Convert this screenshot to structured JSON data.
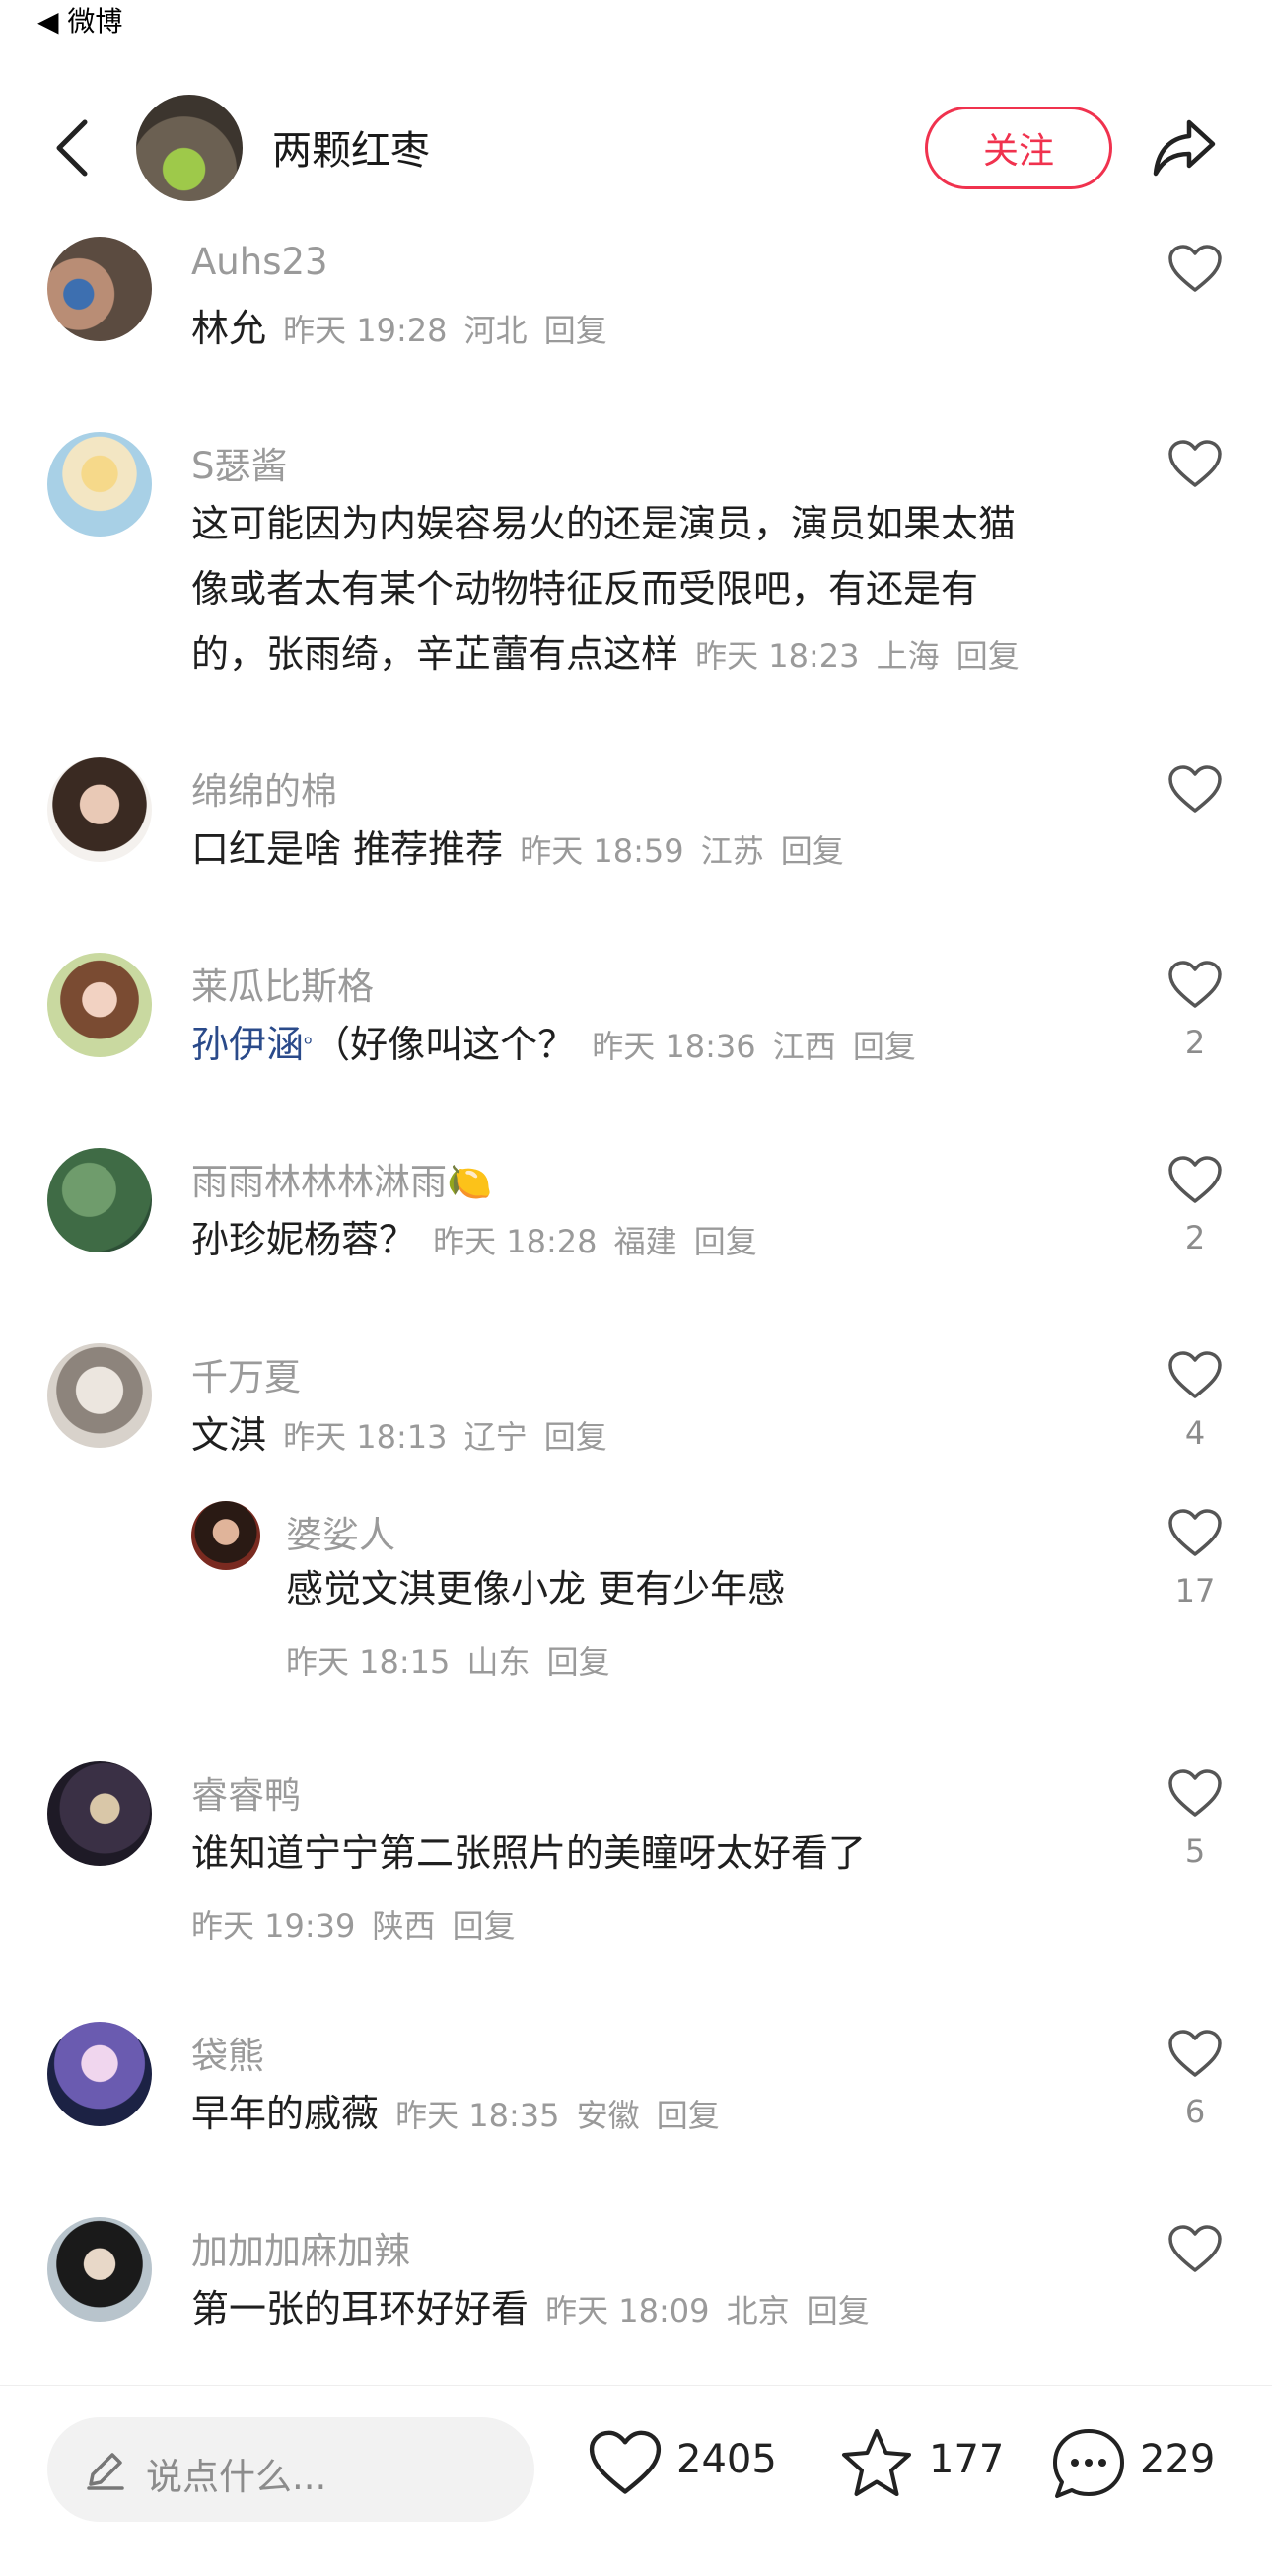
{
  "status_bar": {
    "back_app": "◀ 微博"
  },
  "header": {
    "user_name": "两颗红枣",
    "follow_label": "关注"
  },
  "comments": [
    {
      "name": "Auhs23",
      "text": "林允",
      "time": "昨天 19:28",
      "location": "河北",
      "reply": "回复",
      "likes": ""
    },
    {
      "name": "S瑟酱",
      "line1": "这可能因为内娱容易火的还是演员，演员如果太猫",
      "line2": "像或者太有某个动物特征反而受限吧，有还是有",
      "line3": "的，张雨绮，辛芷蕾有点这样",
      "time": "昨天 18:23",
      "location": "上海",
      "reply": "回复",
      "likes": ""
    },
    {
      "name": "绵绵的棉",
      "text": "口红是啥 推荐推荐",
      "time": "昨天 18:59",
      "location": "江苏",
      "reply": "回复",
      "likes": ""
    },
    {
      "name": "莱瓜比斯格",
      "mention": "孙伊涵",
      "text": "（好像叫这个？",
      "time": "昨天 18:36",
      "location": "江西",
      "reply": "回复",
      "likes": "2"
    },
    {
      "name": "雨雨林林林淋雨",
      "badge": "🍋",
      "text": "孙珍妮杨蓉？",
      "time": "昨天 18:28",
      "location": "福建",
      "reply": "回复",
      "likes": "2"
    },
    {
      "name": "千万夏",
      "text": "文淇",
      "time": "昨天 18:13",
      "location": "辽宁",
      "reply": "回复",
      "likes": "4"
    },
    {
      "name": "婆娑人",
      "text": "感觉文淇更像小龙 更有少年感",
      "time": "昨天 18:15",
      "location": "山东",
      "reply": "回复",
      "likes": "17"
    },
    {
      "name": "睿睿鸭",
      "text": "谁知道宁宁第二张照片的美瞳呀太好看了",
      "time": "昨天 19:39",
      "location": "陕西",
      "reply": "回复",
      "likes": "5"
    },
    {
      "name": "袋熊",
      "text": "早年的戚薇",
      "time": "昨天 18:35",
      "location": "安徽",
      "reply": "回复",
      "likes": "6"
    },
    {
      "name": "加加加麻加辣",
      "text": "第一张的耳环好好看",
      "time": "昨天 18:09",
      "location": "北京",
      "reply": "回复",
      "likes": ""
    }
  ],
  "bottom_bar": {
    "input_placeholder": "说点什么...",
    "likes": "2405",
    "favorites": "177",
    "comments": "229"
  },
  "colors": {
    "accent": "#f0324e",
    "mention": "#2a4a8a",
    "muted": "#9a9a9a"
  }
}
